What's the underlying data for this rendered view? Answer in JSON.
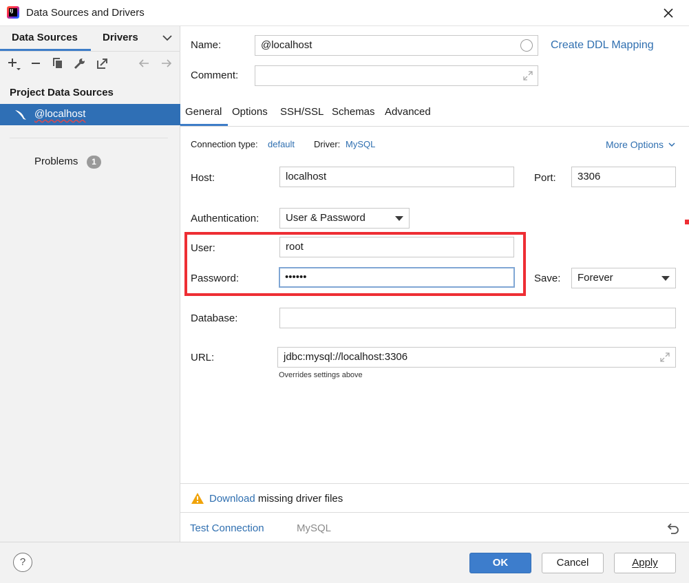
{
  "window": {
    "title": "Data Sources and Drivers"
  },
  "sidebar": {
    "tabs": [
      "Data Sources",
      "Drivers"
    ],
    "section_title": "Project Data Sources",
    "selected_item": "@localhost",
    "problems": {
      "label": "Problems",
      "count": "1"
    }
  },
  "form": {
    "name_label": "Name:",
    "name_value": "@localhost",
    "create_ddl": "Create DDL Mapping",
    "comment_label": "Comment:",
    "comment_value": "",
    "tabs": [
      "General",
      "Options",
      "SSH/SSL",
      "Schemas",
      "Advanced"
    ],
    "connection_type_label": "Connection type:",
    "connection_type_value": "default",
    "driver_label": "Driver:",
    "driver_value": "MySQL",
    "more_options": "More Options",
    "host_label": "Host:",
    "host_value": "localhost",
    "port_label": "Port:",
    "port_value": "3306",
    "auth_label": "Authentication:",
    "auth_value": "User & Password",
    "user_label": "User:",
    "user_value": "root",
    "password_label": "Password:",
    "password_value": "••••••",
    "save_label": "Save:",
    "save_value": "Forever",
    "database_label": "Database:",
    "database_value": "",
    "url_label": "URL:",
    "url_value": "jdbc:mysql://localhost:3306",
    "url_hint": "Overrides settings above"
  },
  "warning": {
    "link": "Download",
    "text": " missing driver files"
  },
  "test": {
    "link": "Test Connection",
    "driver": "MySQL"
  },
  "footer": {
    "help": "?",
    "ok": "OK",
    "cancel": "Cancel",
    "apply": "Apply"
  },
  "colors": {
    "accent": "#2f6fb5",
    "link": "#2f6fb0",
    "highlight": "#ee2e34"
  }
}
